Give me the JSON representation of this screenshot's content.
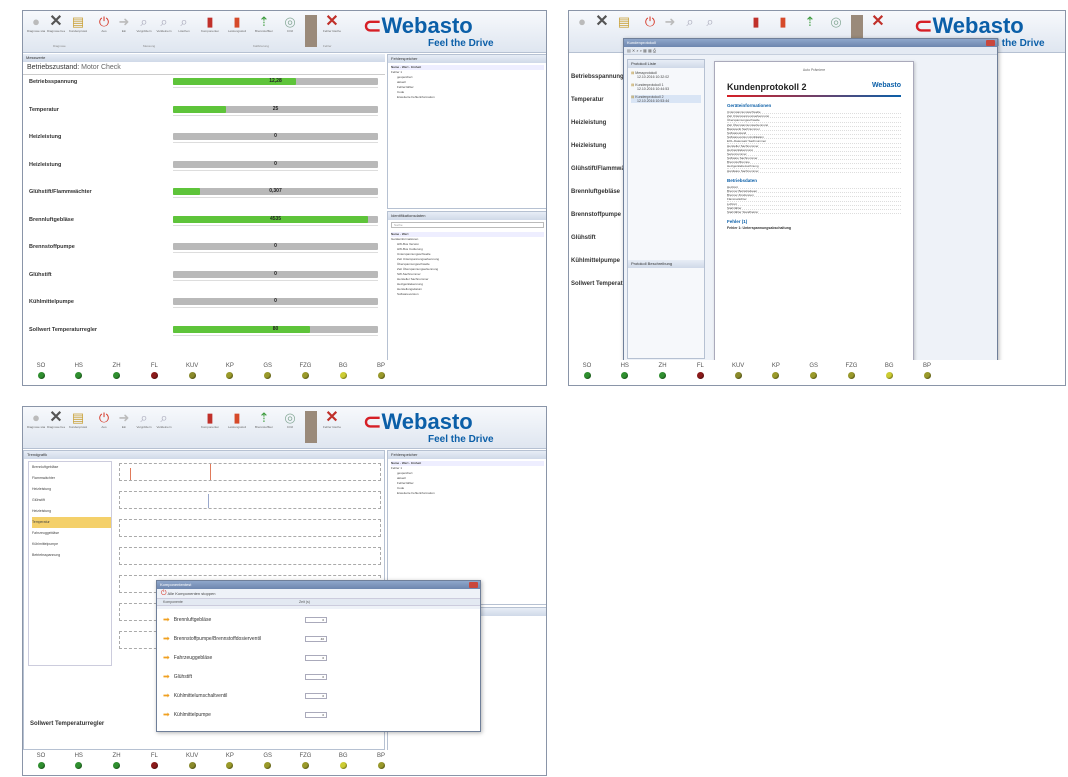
{
  "brand": {
    "logo": "Webasto",
    "slogan": "Feel the Drive"
  },
  "ribbon": {
    "buttons": [
      {
        "icon": "diagnose-start-icon",
        "label": "Diagnose starten"
      },
      {
        "icon": "diagnose-end-icon",
        "label": "Diagnose beenden"
      },
      {
        "icon": "protocol-icon",
        "label": "Kundenprotokoll"
      },
      {
        "icon": "power-icon",
        "label": "Aus"
      },
      {
        "icon": "arrow-icon",
        "label": "Ein"
      },
      {
        "icon": "zoom-icon",
        "label": "Vergrößern"
      },
      {
        "icon": "zoom-out-icon",
        "label": "Verkleinern"
      },
      {
        "icon": "zoom-reset-icon",
        "label": "Löschen"
      },
      {
        "icon": "test-icon",
        "label": "Komponententest"
      },
      {
        "icon": "fault-icon",
        "label": "Leistungsstufe"
      },
      {
        "icon": "fuel-icon",
        "label": "Brennstoffkennzeichen"
      },
      {
        "icon": "co2-icon",
        "label": "CO2"
      },
      {
        "icon": "clear-fault-icon",
        "label": "Fehler löschen"
      }
    ],
    "groups": [
      "Diagnose",
      "Messung",
      "Kalibrierung",
      "Fehler"
    ]
  },
  "screen1": {
    "panel_title": "Messwerte",
    "status_label": "Betriebszustand:",
    "status_value": "Motor Check",
    "sensors": [
      {
        "name": "Betriebsspannung",
        "value": "12,28",
        "fill": 0.6
      },
      {
        "name": "Temperatur",
        "value": "25",
        "fill": 0.26
      },
      {
        "name": "Heizleistung",
        "value": "0",
        "fill": 0
      },
      {
        "name": "Heizleistung",
        "value": "0",
        "fill": 0
      },
      {
        "name": "Glühstift/Flammwächter",
        "value": "0,307",
        "fill": 0.13
      },
      {
        "name": "Brennluftgebläse",
        "value": "4535",
        "fill": 0.95
      },
      {
        "name": "Brennstoffpumpe",
        "value": "0",
        "fill": 0
      },
      {
        "name": "Glühstift",
        "value": "0",
        "fill": 0
      },
      {
        "name": "Kühlmittelpumpe",
        "value": "0",
        "fill": 0
      },
      {
        "name": "Sollwert Temperaturregler",
        "value": "80",
        "fill": 0.67
      }
    ],
    "fault_panel": {
      "title": "Fehlerspeicher",
      "cols": [
        "Name",
        "Wert",
        "Einheit"
      ],
      "rows": [
        "Fehler 1",
        "gespeichert",
        "aktuell",
        "Fehlerzähler",
        "Code",
        "Erweiterte Fehlerinformation"
      ]
    },
    "info_panel": {
      "title": "Identifikationsdaten",
      "search": "Suche",
      "cols": [
        "Name",
        "Wert"
      ],
      "rows": [
        "Geräteinformationen",
        "HW-Bus Version",
        "HW-Bus Codierung",
        "Unterspannungsschwelle",
        "Zeit Unterspannungserkennung",
        "Überspannungsschwelle",
        "Zeit Überspannungserkennung",
        "SW-Sachnummer",
        "Hersteller Sachnummer",
        "Heizgerätekennung",
        "Herstellungsdatum",
        "Softwareversion"
      ]
    }
  },
  "leds": [
    {
      "label": "SO",
      "color": "#2f8f2f"
    },
    {
      "label": "HS",
      "color": "#2f8f2f"
    },
    {
      "label": "ZH",
      "color": "#2f8f2f"
    },
    {
      "label": "FL",
      "color": "#8b1a1a"
    },
    {
      "label": "KUV",
      "color": "#8a8a2a"
    },
    {
      "label": "KP",
      "color": "#9a9a2a"
    },
    {
      "label": "GS",
      "color": "#9a9a2a"
    },
    {
      "label": "FZG",
      "color": "#9a9a2a"
    },
    {
      "label": "BG",
      "color": "#cccc33"
    },
    {
      "label": "BP",
      "color": "#9a9a2a"
    }
  ],
  "screen2": {
    "window_title": "Kundenprotokoll",
    "list_title": "Protokoll Liste",
    "list_items": [
      {
        "name": "Messprotokoll",
        "date": "12.10.2016 10:32:02"
      },
      {
        "name": "Kundenprotokoll 1",
        "date": "12.10.2016 10:44:53"
      },
      {
        "name": "Kundenprotokoll 2",
        "date": "12.10.2016 10:53:44"
      }
    ],
    "desc_title": "Protokoll Beschreibung",
    "doc_header": "Auto Prämiere",
    "doc_title": "Kundenprotokoll 2",
    "doc_section1": "Geräteinformationen",
    "doc_rows1": [
      "Unterspannungsschwelle",
      "Zeit Unterspannungserkennung",
      "Überspannungsschwelle",
      "Zeit Überspannungserkennung",
      "Basisgerät Sachnummer",
      "Softwarestand",
      "Softwareversion Applikation",
      "EOL-Datensatz Sachnummer",
      "Hersteller Sachnummer",
      "Heizgerätekennung",
      "Seriennummer",
      "Software Sachnummer",
      "Brennstoffpumpe",
      "Heizgerätebezeichnung",
      "Hardware Sachnummer"
    ],
    "doc_section2": "Betriebsdaten",
    "doc_rows2": [
      "Heizzeit",
      "Brenner Betriebsdauer",
      "Brenner Zündungen",
      "Flammwächter",
      "Luftzeit",
      "Startzähler",
      "Startzähler Standheizer"
    ],
    "doc_section3": "Fehler (1)",
    "fault_line": "Fehler 1: Unterspannungsabschaltung"
  },
  "screen3": {
    "panel_title": "Trendgrafik",
    "tree_items": [
      "Brennluftgebläse",
      "Flammwächter",
      "Heizleistung",
      "Glühstift",
      "Heizleistung",
      "Temperatur",
      "Fahrzeuggebläse",
      "Kühlmittelpumpe",
      "Betriebsspannung"
    ],
    "dialog_title": "Komponententest",
    "dialog_subtitle": "Alle Komponenten stoppen",
    "dialog_cols": [
      "Komponente",
      "Zeit (s)"
    ],
    "components": [
      {
        "name": "Brennluftgebläse",
        "value": "0"
      },
      {
        "name": "Brennstoffpumpe/Brennstoffdosierventil",
        "value": "40"
      },
      {
        "name": "Fahrzeuggebläse",
        "value": "0"
      },
      {
        "name": "Glühstift",
        "value": "0"
      },
      {
        "name": "Kühlmittelumschaltventil",
        "value": "0"
      },
      {
        "name": "Kühlmittelpumpe",
        "value": "0"
      }
    ],
    "bottom_label": "Sollwert Temperaturregler"
  }
}
